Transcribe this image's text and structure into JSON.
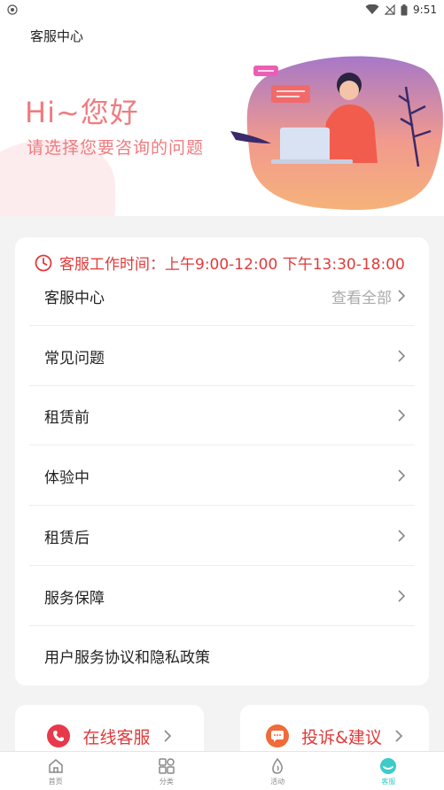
{
  "status_bar": {
    "time": "9:51"
  },
  "header": {
    "title": "客服中心"
  },
  "banner": {
    "greeting": "Hi~您好",
    "subtitle": "请选择您要咨询的问题"
  },
  "service": {
    "hours": "客服工作时间：上午9:00-12:00 下午13:30-18:00",
    "section_title": "客服中心",
    "view_all": "查看全部",
    "items": [
      {
        "label": "常见问题"
      },
      {
        "label": "租赁前"
      },
      {
        "label": "体验中"
      },
      {
        "label": "租赁后"
      },
      {
        "label": "服务保障"
      },
      {
        "label": "用户服务协议和隐私政策"
      }
    ]
  },
  "actions": {
    "online": "在线客服",
    "complaint": "投诉&建议"
  },
  "tabs": [
    {
      "label": "首页",
      "icon": "home-icon"
    },
    {
      "label": "分类",
      "icon": "category-icon"
    },
    {
      "label": "活动",
      "icon": "activity-icon"
    },
    {
      "label": "客服",
      "icon": "service-icon"
    }
  ],
  "colors": {
    "accent_red": "#e03a3a",
    "banner_pink": "#f07b7f",
    "tab_active": "#3ccbc8"
  }
}
